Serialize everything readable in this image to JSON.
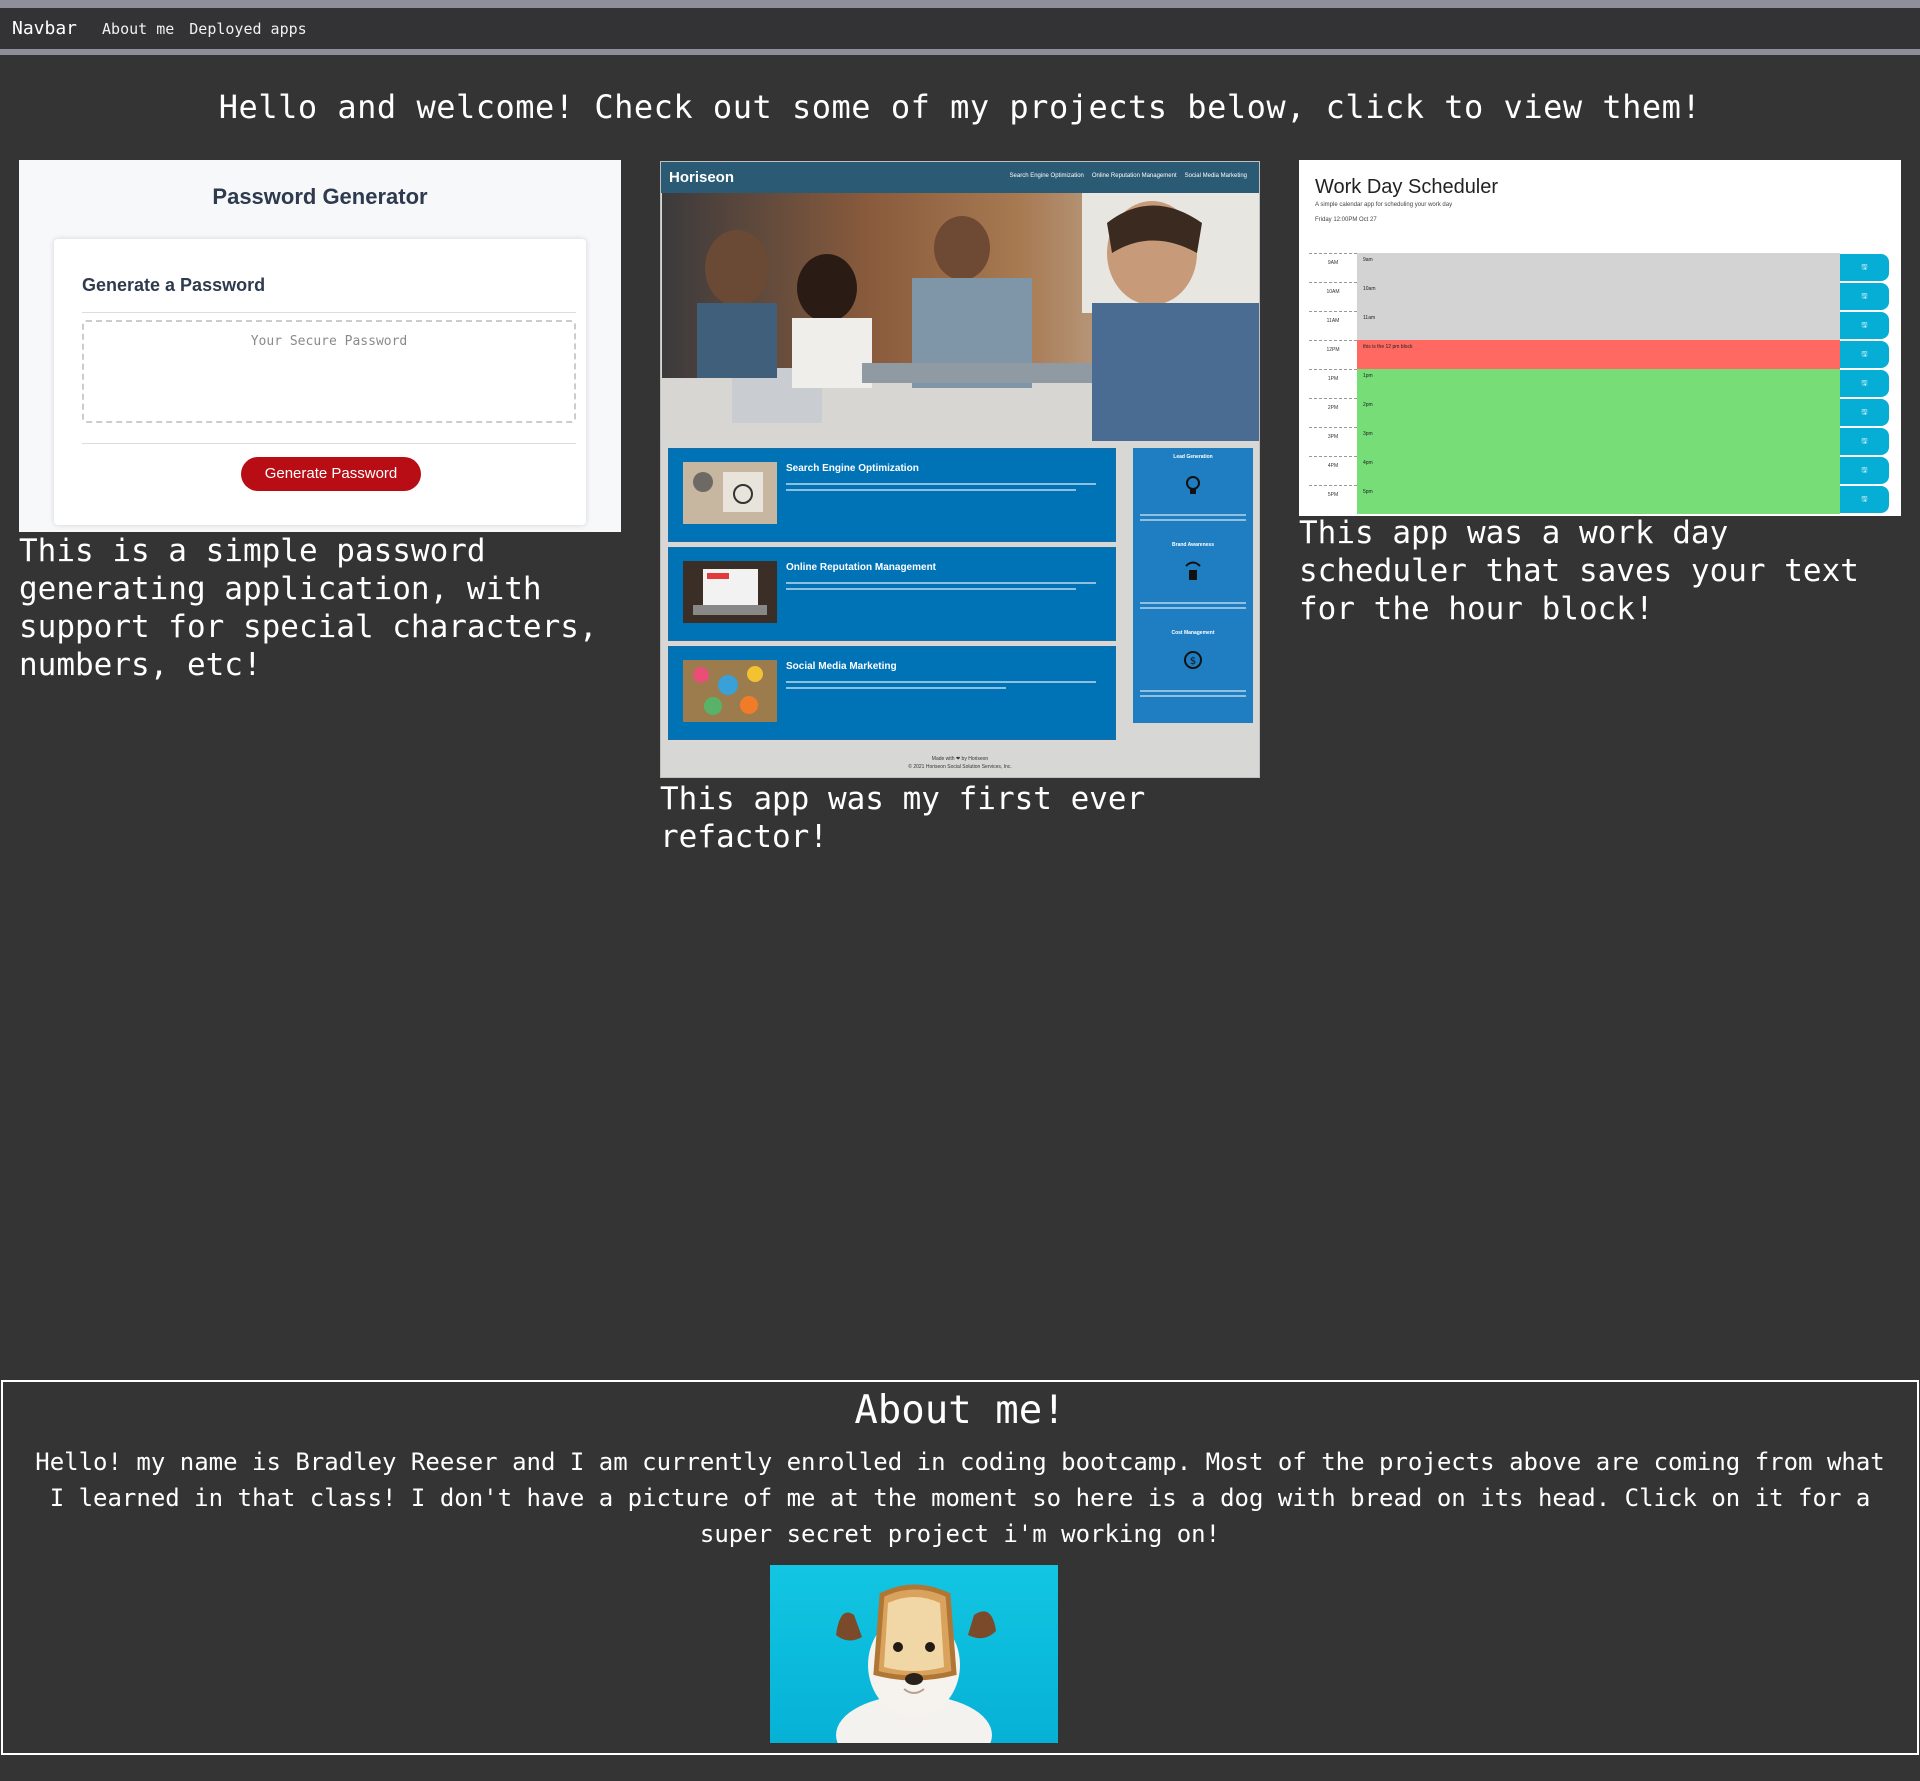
{
  "navbar": {
    "brand": "Navbar",
    "links": [
      "About me",
      "Deployed apps"
    ]
  },
  "welcome": "Hello and welcome! Check out some of my projects below, click to view them!",
  "projects": [
    {
      "description": "This is a simple password generating application, with support for special characters, numbers, etc!",
      "thumbnail": {
        "title": "Password Generator",
        "card_title": "Generate a Password",
        "placeholder": "Your Secure Password",
        "button": "Generate Password"
      }
    },
    {
      "description": "This app was my first ever refactor!",
      "thumbnail": {
        "logo": "Horiseon",
        "nav": [
          "Search Engine Optimization",
          "Online Reputation Management",
          "Social Media Marketing"
        ],
        "cards": [
          "Search Engine Optimization",
          "Online Reputation Management",
          "Social Media Marketing"
        ],
        "side": [
          "Lead Generation",
          "Brand Awareness",
          "Cost Management"
        ],
        "footer_line1": "Made with ❤ by Horiseon",
        "footer_line2": "© 2021 Horiseon Social Solution Services, Inc."
      }
    },
    {
      "description": "This app was a work day scheduler that saves your text for the hour block!",
      "thumbnail": {
        "title": "Work Day Scheduler",
        "subtitle": "A simple calendar app for scheduling your work day",
        "date": "Friday 12:00PM Oct 27",
        "rows": [
          {
            "hour": "9AM",
            "text": "9am",
            "state": "past"
          },
          {
            "hour": "10AM",
            "text": "10am",
            "state": "past"
          },
          {
            "hour": "11AM",
            "text": "11am",
            "state": "past"
          },
          {
            "hour": "12PM",
            "text": "this is the 12 pm block",
            "state": "present"
          },
          {
            "hour": "1PM",
            "text": "1pm",
            "state": "future"
          },
          {
            "hour": "2PM",
            "text": "2pm",
            "state": "future"
          },
          {
            "hour": "3PM",
            "text": "3pm",
            "state": "future"
          },
          {
            "hour": "4PM",
            "text": "4pm",
            "state": "future"
          },
          {
            "hour": "5PM",
            "text": "5pm",
            "state": "future"
          }
        ],
        "colors": {
          "past": "#d3d3d3",
          "present": "#ff6961",
          "future": "#77dd77",
          "save": "#06aed5"
        }
      }
    }
  ],
  "about": {
    "title": "About me!",
    "text": "Hello! my name is Bradley Reeser and I am currently enrolled in coding bootcamp. Most of the projects above are coming from what I learned in that class! I don't have a picture of me at the moment so here is a dog with bread on its head. Click on it for a super secret project i'm working on!"
  },
  "colors": {
    "background": "#353435",
    "nav_rule": "#8f8e9b",
    "horiseon_blue": "#0073b7",
    "generate_button": "#b80d14"
  }
}
